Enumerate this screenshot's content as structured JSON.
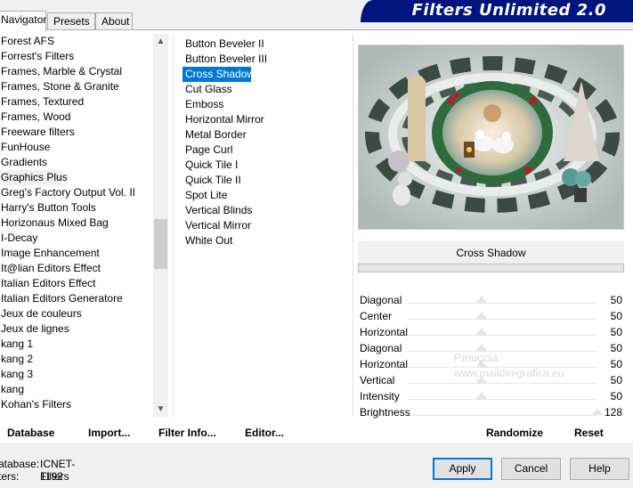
{
  "tabs": [
    {
      "label": "Navigator",
      "active": true
    },
    {
      "label": "Presets",
      "active": false
    },
    {
      "label": "About",
      "active": false
    }
  ],
  "app_title": "Filters Unlimited 2.0",
  "categories": {
    "items": [
      "Forest AFS",
      "Forrest's Filters",
      "Frames, Marble & Crystal",
      "Frames, Stone & Granite",
      "Frames, Textured",
      "Frames, Wood",
      "Freeware filters",
      "FunHouse",
      "Gradients",
      "Graphics Plus",
      "Greg's Factory Output Vol. II",
      "Harry's Button Tools",
      "Horizonaus Mixed Bag",
      "I-Decay",
      "Image Enhancement",
      "It@lian Editors Effect",
      "Italian Editors Effect",
      "Italian Editors Generatore",
      "Jeux de couleurs",
      "Jeux de lignes",
      "kang 1",
      "kang 2",
      "kang 3",
      "kang",
      "Kohan's Filters"
    ],
    "selected": "Graphics Plus"
  },
  "filters": {
    "items": [
      "Button Beveler II",
      "Button Beveler III",
      "Cross Shadow",
      "Cut Glass",
      "Emboss",
      "Horizontal Mirror",
      "Metal Border",
      "Page Curl",
      "Quick Tile I",
      "Quick Tile II",
      "Spot Lite",
      "Vertical Blinds",
      "Vertical Mirror",
      "White Out"
    ],
    "selected": "Cross Shadow"
  },
  "preview": {
    "filter_name": "Cross Shadow"
  },
  "params": [
    {
      "name": "Diagonal",
      "value": "50",
      "fraction": 0.39
    },
    {
      "name": "Center",
      "value": "50",
      "fraction": 0.39
    },
    {
      "name": "Horizontal",
      "value": "50",
      "fraction": 0.39
    },
    {
      "name": "Diagonal",
      "value": "50",
      "fraction": 0.39
    },
    {
      "name": "Horizontal",
      "value": "50",
      "fraction": 0.39
    },
    {
      "name": "Vertical",
      "value": "50",
      "fraction": 0.39
    },
    {
      "name": "Intensity",
      "value": "50",
      "fraction": 0.39
    },
    {
      "name": "Brightness",
      "value": "128",
      "fraction": 1.0
    }
  ],
  "watermark": {
    "line1": "Pinuccia",
    "line2": "www.maildiregrafica.eu"
  },
  "actions": {
    "database": "Database",
    "import": "Import...",
    "filter_info": "Filter Info...",
    "editor": "Editor...",
    "randomize": "Randomize",
    "reset": "Reset"
  },
  "status": {
    "database_label": "atabase:",
    "database_value": "ICNET-Filters",
    "filters_label": "ters:",
    "filters_value": "1192"
  },
  "buttons": {
    "apply": "Apply",
    "cancel": "Cancel",
    "help": "Help"
  },
  "colors": {
    "selection": "#0078d7",
    "banner": "#001480"
  }
}
